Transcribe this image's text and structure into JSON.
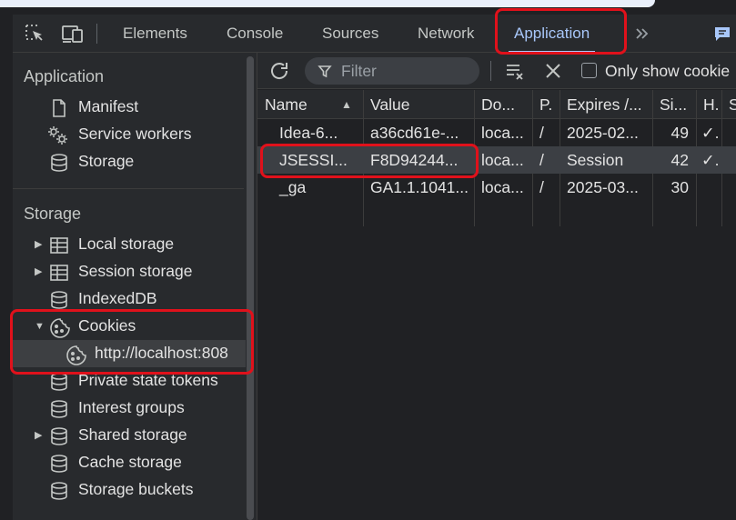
{
  "devtools": {
    "tabs": [
      {
        "label": "Elements"
      },
      {
        "label": "Console"
      },
      {
        "label": "Sources"
      },
      {
        "label": "Network"
      },
      {
        "label": "Application"
      }
    ],
    "active_tab": "Application",
    "accent_color": "#a8c7fa",
    "highlight_color": "#e0111b"
  },
  "sidebar": {
    "application_title": "Application",
    "application_items": [
      {
        "label": "Manifest",
        "icon": "document-icon"
      },
      {
        "label": "Service workers",
        "icon": "gears-icon"
      },
      {
        "label": "Storage",
        "icon": "database-icon"
      }
    ],
    "storage_title": "Storage",
    "storage_items": [
      {
        "label": "Local storage",
        "icon": "table-icon",
        "expandable": true
      },
      {
        "label": "Session storage",
        "icon": "table-icon",
        "expandable": true
      },
      {
        "label": "IndexedDB",
        "icon": "database-icon"
      },
      {
        "label": "Cookies",
        "icon": "cookie-icon",
        "expanded": true
      },
      {
        "label": "http://localhost:808",
        "icon": "cookie-icon",
        "selected": true
      },
      {
        "label": "Private state tokens",
        "icon": "database-icon"
      },
      {
        "label": "Interest groups",
        "icon": "database-icon"
      },
      {
        "label": "Shared storage",
        "icon": "database-icon",
        "expandable": true
      },
      {
        "label": "Cache storage",
        "icon": "database-icon"
      },
      {
        "label": "Storage buckets",
        "icon": "database-icon"
      }
    ]
  },
  "toolbar": {
    "filter_placeholder": "Filter",
    "only_show_label": "Only show cookie"
  },
  "cookies_table": {
    "columns": [
      "Name",
      "Value",
      "Do...",
      "P.",
      "Expires /...",
      "Si...",
      "H.",
      "S"
    ],
    "sort_indicator": "▲",
    "rows": [
      {
        "name": "Idea-6...",
        "value": "a36cd61e-...",
        "domain": "loca...",
        "path": "/",
        "expires": "2025-02...",
        "size": "49",
        "http": "✓."
      },
      {
        "name": "JSESSI...",
        "value": "F8D94244...",
        "domain": "loca...",
        "path": "/",
        "expires": "Session",
        "size": "42",
        "http": "✓."
      },
      {
        "name": "_ga",
        "value": "GA1.1.1041...",
        "domain": "loca...",
        "path": "/",
        "expires": "2025-03...",
        "size": "30",
        "http": ""
      }
    ]
  }
}
